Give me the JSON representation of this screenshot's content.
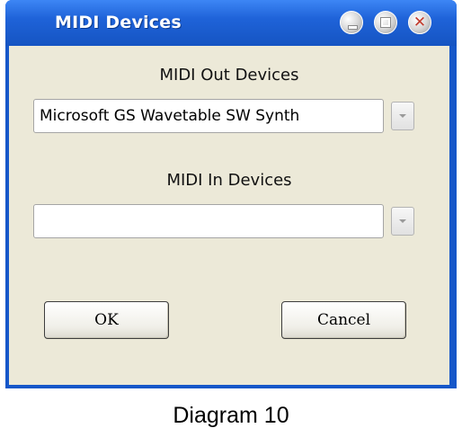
{
  "window": {
    "title": "MIDI Devices",
    "controls": {
      "minimize_icon": "minimize-icon",
      "maximize_icon": "maximize-icon",
      "close_icon": "close-icon",
      "close_glyph": "✕"
    }
  },
  "midi_out": {
    "label": "MIDI Out Devices",
    "selected": "Microsoft GS Wavetable SW Synth",
    "dropdown_icon": "chevron-down-icon"
  },
  "midi_in": {
    "label": "MIDI In Devices",
    "selected": "",
    "dropdown_icon": "chevron-down-icon"
  },
  "buttons": {
    "ok_label": "OK",
    "cancel_label": "Cancel"
  },
  "caption": "Diagram 10",
  "colors": {
    "titlebar": "#1f63d9",
    "client": "#ece9d8",
    "close_glyph": "#c0392b"
  }
}
